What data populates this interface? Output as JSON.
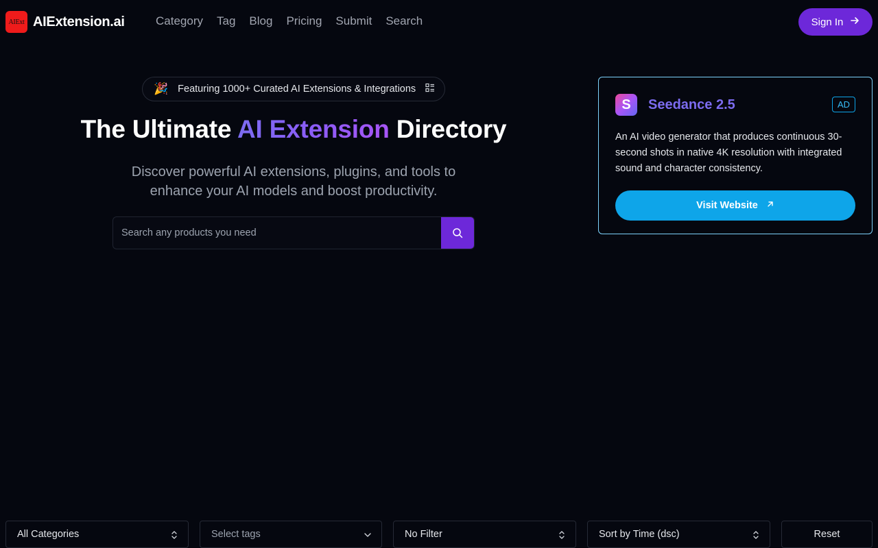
{
  "header": {
    "logo_mark": "AIExt",
    "logo_text": "AIExtension.ai",
    "nav": [
      "Category",
      "Tag",
      "Blog",
      "Pricing",
      "Submit",
      "Search"
    ],
    "signin_label": "Sign In"
  },
  "hero": {
    "pill_text": "Featuring 1000+ Curated AI Extensions & Integrations",
    "title_pre": "The Ultimate ",
    "title_highlight": "AI Extension",
    "title_post": " Directory",
    "subtitle": "Discover powerful AI extensions, plugins, and tools to enhance your AI models and boost productivity.",
    "search_placeholder": "Search any products you need"
  },
  "ad": {
    "logo_letter": "S",
    "name": "Seedance 2.5",
    "badge": "AD",
    "description": "An AI video generator that produces continuous 30-second shots in native 4K resolution with integrated sound and character consistency.",
    "button_label": "Visit Website"
  },
  "filters": {
    "category": "All Categories",
    "tags_placeholder": "Select tags",
    "filter": "No Filter",
    "sort": "Sort by Time (dsc)",
    "reset": "Reset"
  },
  "colors": {
    "background": "#05070f",
    "accent_purple": "#6d28d9",
    "accent_blue": "#0ea5e9",
    "logo_red": "#ef1b1b"
  },
  "icons": [
    "party-popper-icon",
    "list-icon",
    "arrow-right-icon",
    "search-icon",
    "arrow-up-right-icon",
    "chevron-up-down-icon",
    "chevron-down-icon"
  ]
}
